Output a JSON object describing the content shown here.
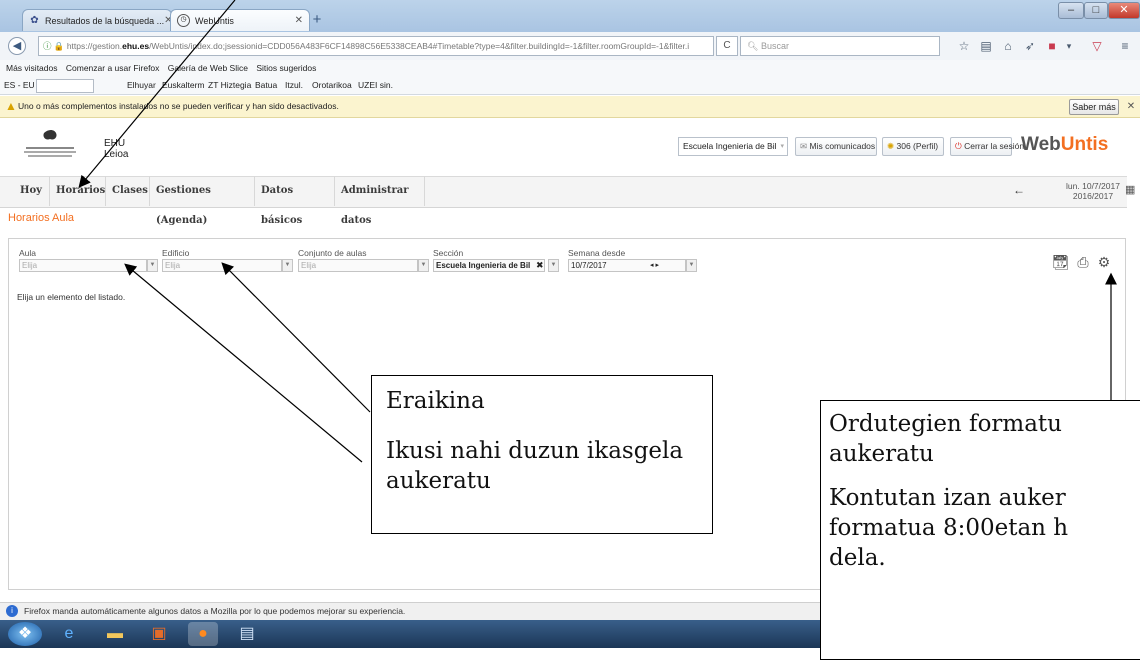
{
  "browser": {
    "tabs": [
      {
        "label": "Resultados de la búsqueda ...",
        "icon": "hub-icon"
      },
      {
        "label": "WebUntis",
        "icon": "clock-icon"
      }
    ],
    "url_prefix": "https://gestion.",
    "url_domain": "ehu.es",
    "url_rest": "/WebUntis/index.do;jsessionid=CDD056A483F6CF14898C56E5338CEAB4#Timetable?type=4&filter.buildingId=-1&filter.roomGroupId=-1&filter.i",
    "search_placeholder": "Buscar",
    "bookmarks": [
      "Más visitados",
      "Comenzar a usar Firefox",
      "Galería de Web Slice",
      "Sitios sugeridos"
    ],
    "toolbar_lang": "ES - EU",
    "toolbar_links": [
      "Elhuyar",
      "Euskalterm",
      "ZT Hiztegia",
      "Batua",
      "Itzul.",
      "Orotarikoa",
      "UZEI sin."
    ],
    "notice": "Uno o más complementos instalados no se pueden verificar y han sido desactivados.",
    "notice_button": "Saber más",
    "status_text": "Firefox manda automáticamente algunos datos a Mozilla por lo que podemos mejorar su experiencia."
  },
  "header": {
    "school_line1": "EHU",
    "school_line2": "Leioa",
    "school_select": "Escuela Ingenieria de Bil",
    "messages_button": "Mis comunicados",
    "profile_button": "306 (Perfil)",
    "logout_button": "Cerrar la sesión",
    "brand_a": "Web",
    "brand_b": "Untis"
  },
  "menu": {
    "items": [
      "Hoy",
      "Horarios",
      "Clases",
      "Gestiones (Agenda)",
      "Datos básicos",
      "Administrar datos"
    ],
    "date_line1": "lun. 10/7/2017",
    "date_line2": "2016/2017"
  },
  "page": {
    "title": "Horarios Aula",
    "filters": {
      "aula_label": "Aula",
      "aula_placeholder": "Elija",
      "edificio_label": "Edificio",
      "edificio_placeholder": "Elija",
      "conjunto_label": "Conjunto de aulas",
      "conjunto_placeholder": "Elija",
      "seccion_label": "Sección",
      "seccion_value": "Escuela Ingenieria de Bil",
      "semana_label": "Semana desde",
      "semana_value": "10/7/2017"
    },
    "empty_message": "Elija un elemento del listado."
  },
  "annotations": {
    "box1_line1": "Eraikina",
    "box1_line2": "Ikusi nahi duzun ikasgela aukeratu",
    "box2_line1": "Ordutegien formatu",
    "box2_line2": "aukeratu",
    "box2_line3": "Kontutan izan auker",
    "box2_line4": "formatua 8:00etan h",
    "box2_line5": "dela."
  }
}
